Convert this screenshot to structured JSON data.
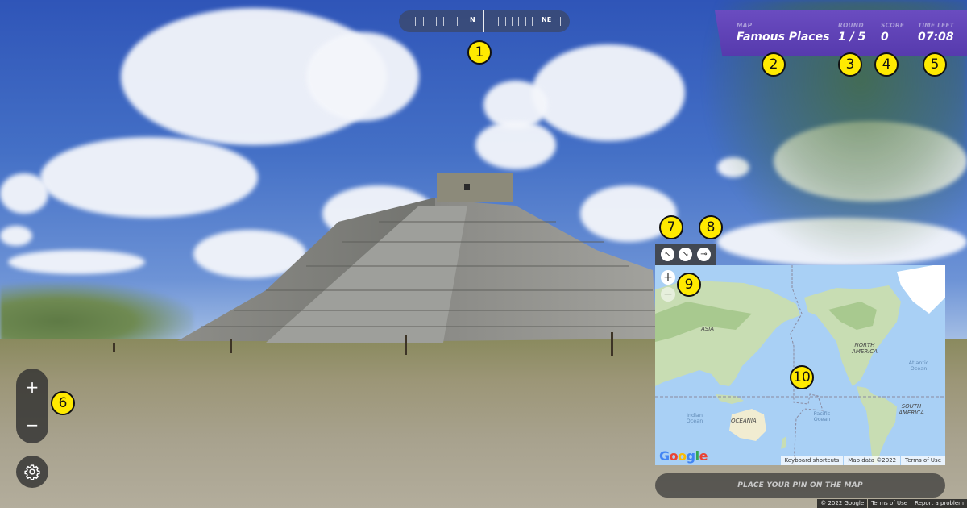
{
  "scene": {
    "description": "Street view panorama of a stepped pyramid under a blue cloudy sky"
  },
  "compass": {
    "labels": [
      {
        "text": "N",
        "heading": "north"
      },
      {
        "text": "NE",
        "heading": "northeast"
      }
    ]
  },
  "status": {
    "map": {
      "key": "MAP",
      "value": "Famous Places"
    },
    "round": {
      "key": "ROUND",
      "value": "1 / 5"
    },
    "score": {
      "key": "SCORE",
      "value": "0"
    },
    "time": {
      "key": "TIME LEFT",
      "value": "07:08"
    }
  },
  "controls": {
    "zoom_in": "+",
    "zoom_out": "−",
    "settings_icon": "gear-icon"
  },
  "map_toolbar": {
    "tools": [
      {
        "name": "expand-map",
        "icon": "arrow-up-left-icon",
        "glyph": "↖"
      },
      {
        "name": "shrink-map",
        "icon": "arrow-down-right-icon",
        "glyph": "↘"
      },
      {
        "name": "pin-map",
        "icon": "pin-icon",
        "glyph": "⊸"
      }
    ]
  },
  "map": {
    "zoom_in": "+",
    "zoom_out": "−",
    "continents": [
      "ASIA",
      "NORTH AMERICA",
      "SOUTH AMERICA",
      "OCEANIA"
    ],
    "oceans": [
      "Atlantic Ocean",
      "Indian Ocean",
      "Pacific Ocean"
    ],
    "logo": "Google",
    "attribution": [
      "Keyboard shortcuts",
      "Map data ©2022",
      "Terms of Use"
    ]
  },
  "guess_button": {
    "label": "PLACE YOUR PIN ON THE MAP"
  },
  "footer": {
    "attribution": [
      "© 2022 Google",
      "Terms of Use",
      "Report a problem"
    ]
  },
  "callouts": [
    "1",
    "2",
    "3",
    "4",
    "5",
    "6",
    "7",
    "8",
    "9",
    "10"
  ]
}
